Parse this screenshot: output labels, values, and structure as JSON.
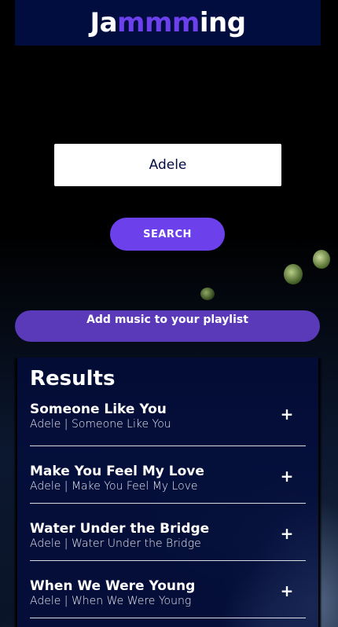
{
  "app": {
    "logo_prefix": "Ja",
    "logo_accent": "mmm",
    "logo_suffix": "ing"
  },
  "search": {
    "value": "Adele",
    "button_label": "SEARCH"
  },
  "banner": {
    "label": "Add music to your playlist"
  },
  "results": {
    "title": "Results",
    "tracks": [
      {
        "name": "Someone Like You",
        "meta": "Adele | Someone Like You",
        "action_icon": "plus-icon"
      },
      {
        "name": "Make You Feel My Love",
        "meta": "Adele | Make You Feel My Love",
        "action_icon": "plus-icon"
      },
      {
        "name": "Water Under the Bridge",
        "meta": "Adele | Water Under the Bridge",
        "action_icon": "plus-icon"
      },
      {
        "name": "When We Were Young",
        "meta": "Adele | When We Were Young",
        "action_icon": "plus-icon"
      }
    ],
    "add_symbol": "+"
  },
  "colors": {
    "header_bg": "#010c3f",
    "accent": "#6c41ec",
    "banner_bg": "#5b3aba"
  }
}
